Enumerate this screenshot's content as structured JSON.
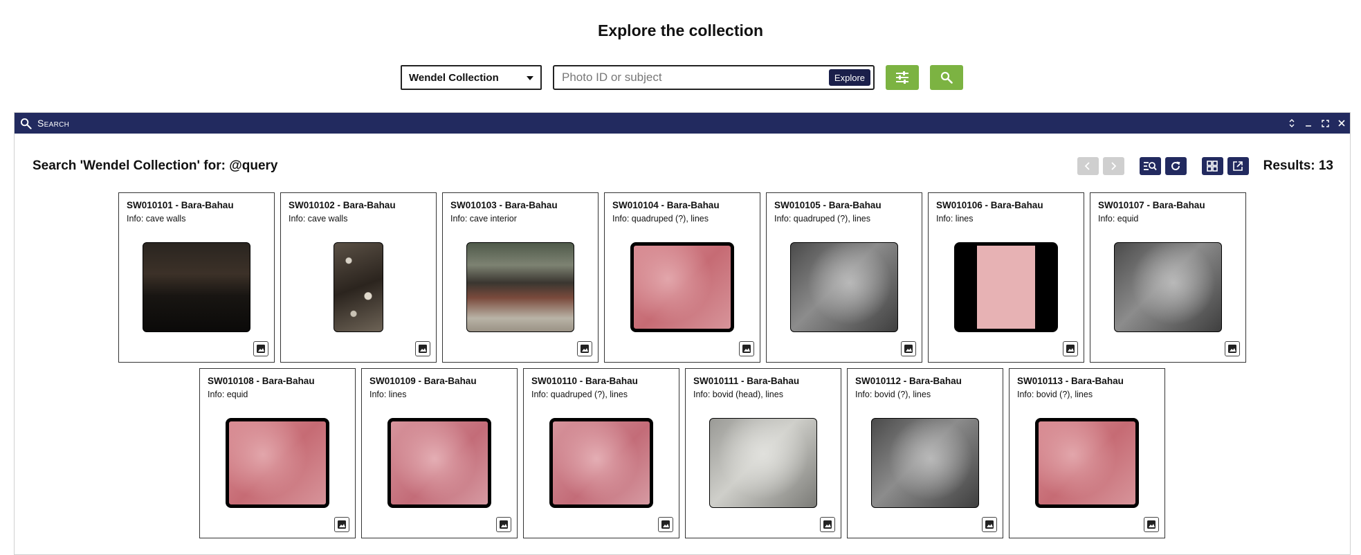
{
  "page": {
    "title": "Explore the collection"
  },
  "search": {
    "collection": "Wendel Collection",
    "placeholder": "Photo ID or subject",
    "explore_label": "Explore"
  },
  "window": {
    "title": "Search",
    "query_title": "Search 'Wendel Collection' for: @query",
    "results_label": "Results: 13"
  },
  "colors": {
    "accent_green": "#7cb342",
    "navy": "#222a5f"
  },
  "items": [
    {
      "title": "SW010101 - Bara-Bahau",
      "info": "Info: cave walls",
      "thumb": "dark-cave"
    },
    {
      "title": "SW010102 - Bara-Bahau",
      "info": "Info: cave walls",
      "thumb": "speckled"
    },
    {
      "title": "SW010103 - Bara-Bahau",
      "info": "Info: cave interior",
      "thumb": "cave-interior"
    },
    {
      "title": "SW010104 - Bara-Bahau",
      "info": "Info: quadruped (?), lines",
      "thumb": "red-rock"
    },
    {
      "title": "SW010105 - Bara-Bahau",
      "info": "Info: quadruped (?), lines",
      "thumb": "gray-rock"
    },
    {
      "title": "SW010106 - Bara-Bahau",
      "info": "Info: lines",
      "thumb": "red-panel"
    },
    {
      "title": "SW010107 - Bara-Bahau",
      "info": "Info: equid",
      "thumb": "gray-rock"
    },
    {
      "title": "SW010108 - Bara-Bahau",
      "info": "Info: equid",
      "thumb": "red-rock"
    },
    {
      "title": "SW010109 - Bara-Bahau",
      "info": "Info: lines",
      "thumb": "pink-rock"
    },
    {
      "title": "SW010110 - Bara-Bahau",
      "info": "Info: quadruped (?), lines",
      "thumb": "pink-rock"
    },
    {
      "title": "SW010111 - Bara-Bahau",
      "info": "Info: bovid (head), lines",
      "thumb": "light-gray"
    },
    {
      "title": "SW010112 - Bara-Bahau",
      "info": "Info: bovid (?), lines",
      "thumb": "gray-rock"
    },
    {
      "title": "SW010113 - Bara-Bahau",
      "info": "Info: bovid (?), lines",
      "thumb": "red-rock"
    }
  ]
}
